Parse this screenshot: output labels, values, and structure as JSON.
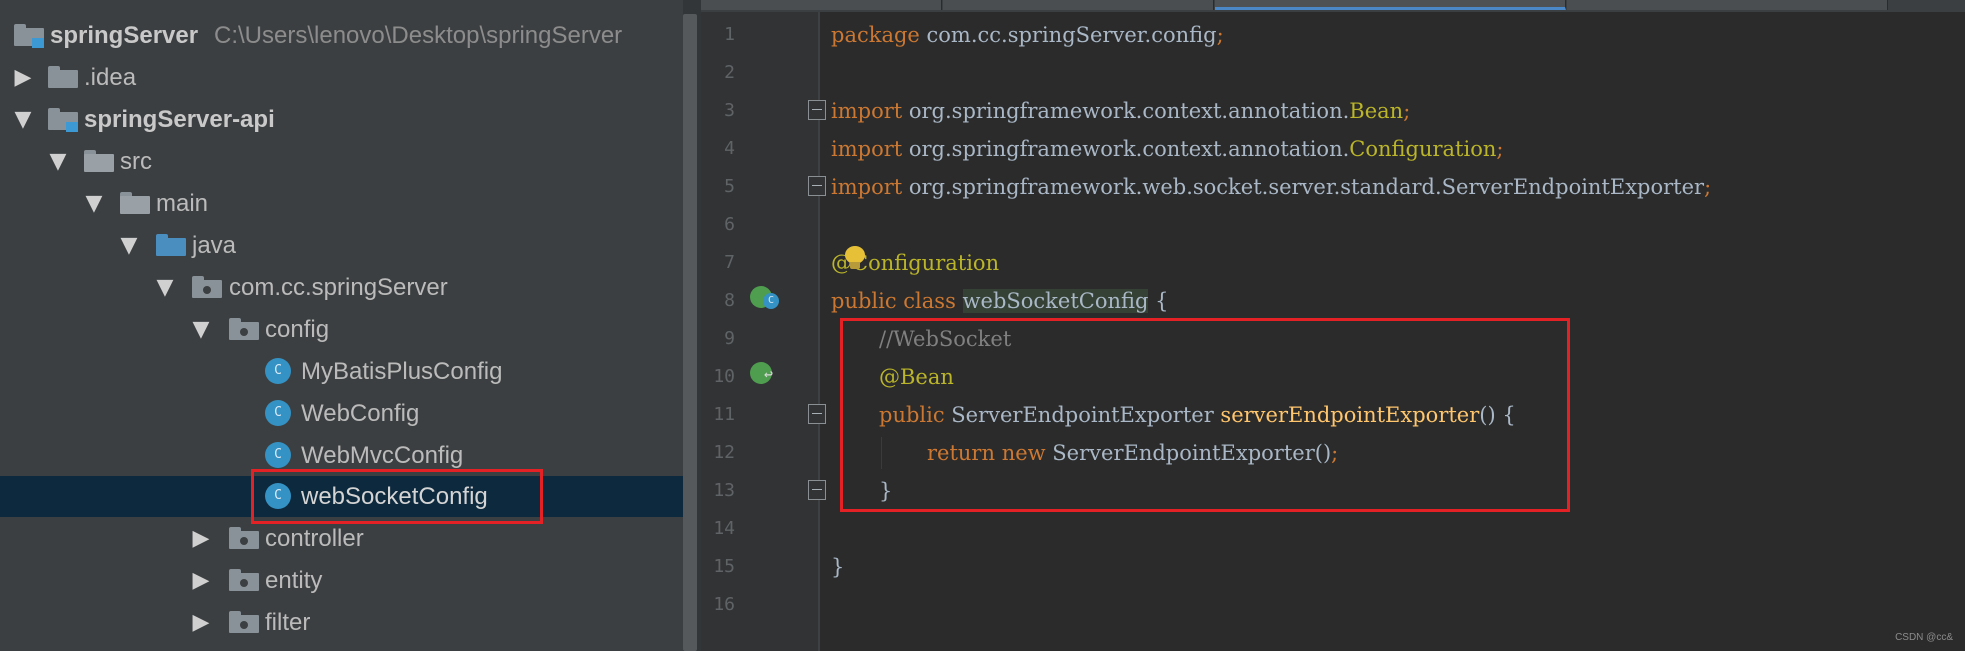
{
  "project": {
    "root_name": "springServer",
    "root_path": "C:\\Users\\lenovo\\Desktop\\springServer",
    "items": [
      {
        "label": ".idea"
      },
      {
        "label": "springServer-api"
      },
      {
        "label": "src"
      },
      {
        "label": "main"
      },
      {
        "label": "java"
      },
      {
        "label": "com.cc.springServer"
      },
      {
        "label": "config"
      },
      {
        "label": "MyBatisPlusConfig"
      },
      {
        "label": "WebConfig"
      },
      {
        "label": "WebMvcConfig"
      },
      {
        "label": "webSocketConfig"
      },
      {
        "label": "controller"
      },
      {
        "label": "entity"
      },
      {
        "label": "filter"
      }
    ],
    "class_icon_letter": "C"
  },
  "editor": {
    "line_numbers": [
      "1",
      "2",
      "3",
      "4",
      "5",
      "6",
      "7",
      "8",
      "9",
      "10",
      "11",
      "12",
      "13",
      "14",
      "15",
      "16"
    ],
    "code": {
      "package_kw": "package",
      "package_name": " com.cc.springServer.config",
      "import_kw": "import",
      "import1_path": " org.springframework.context.annotation.",
      "import1_class": "Bean",
      "import2_path": " org.springframework.context.annotation.",
      "import2_class": "Configuration",
      "import3_path": " org.springframework.web.socket.server.standard.ServerEndpointExporter",
      "semicolon": ";",
      "annotation_config_at": "@",
      "annotation_config_rest": "Configuration",
      "public_kw": "public",
      "class_kw": "class",
      "class_name": "webSocketConfig",
      "open_brace": " {",
      "comment": "//WebSocket",
      "annotation_bean": "@Bean",
      "return_type": " ServerEndpointExporter ",
      "method_name": "serverEndpointExporter",
      "method_tail": "() {",
      "return_kw": "return",
      "new_kw": "new",
      "return_expr": " ServerEndpointExporter()",
      "close_brace": "}"
    }
  },
  "colors": {
    "highlight_box": "#e42226",
    "keyword": "#cc7832",
    "annotation": "#bbb529",
    "method": "#ffc66d",
    "comment": "#808080"
  },
  "watermark": "CSDN @cc&"
}
